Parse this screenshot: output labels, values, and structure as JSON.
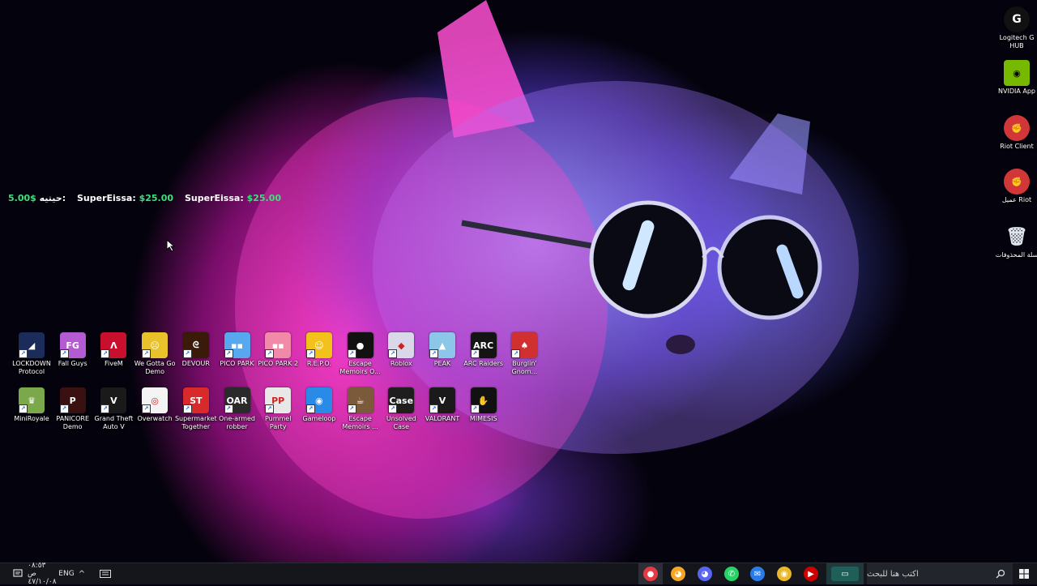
{
  "donations": [
    {
      "name": "حيتيه:",
      "amount": "5.00$"
    },
    {
      "name": "SuperEissa:",
      "amount": "$25.00"
    },
    {
      "name": "SuperEissa:",
      "amount": "$25.00"
    }
  ],
  "right_icons": [
    {
      "label": "Logitech G HUB",
      "icon": "logitech-g-icon"
    },
    {
      "label": "NVIDIA App",
      "icon": "nvidia-icon"
    },
    {
      "label": "Riot Client",
      "icon": "riot-icon"
    },
    {
      "label": "عميل Riot",
      "icon": "riot-icon"
    },
    {
      "label": "سلة المحذوفات",
      "icon": "recycle-bin-icon"
    }
  ],
  "row1": [
    {
      "label": "LOCKDOWN Protocol",
      "color": "#1c2c5a",
      "glyph": "◢"
    },
    {
      "label": "Fall Guys",
      "color": "#b45ad2",
      "glyph": "FG"
    },
    {
      "label": "FiveM",
      "color": "#c8102e",
      "glyph": "Λ"
    },
    {
      "label": "We Gotta Go Demo",
      "color": "#e8c12b",
      "glyph": "☹"
    },
    {
      "label": "DEVOUR",
      "color": "#3a1a08",
      "glyph": "ᘓ"
    },
    {
      "label": "PICO PARK",
      "color": "#58a8f0",
      "glyph": "▪▪"
    },
    {
      "label": "PICO PARK 2",
      "color": "#f08aa8",
      "glyph": "▪▪"
    },
    {
      "label": "R.E.P.O.",
      "color": "#f3c21a",
      "glyph": "☺"
    },
    {
      "label": "Escape Memoirs O...",
      "color": "#111111",
      "glyph": "●"
    },
    {
      "label": "Roblox",
      "color": "#d8d8e8",
      "glyph": "◆"
    },
    {
      "label": "PEAK",
      "color": "#8cc6e8",
      "glyph": "▲"
    },
    {
      "label": "ARC Raiders",
      "color": "#141414",
      "glyph": "ARC"
    },
    {
      "label": "Burglin' Gnom...",
      "color": "#d03030",
      "glyph": "♠"
    }
  ],
  "row2": [
    {
      "label": "MiniRoyale",
      "color": "#7aa84a",
      "glyph": "♛"
    },
    {
      "label": "PANICORE Demo",
      "color": "#3a1010",
      "glyph": "P"
    },
    {
      "label": "Grand Theft Auto V",
      "color": "#1a1a1a",
      "glyph": "V"
    },
    {
      "label": "Overwatch",
      "color": "#f4f4f4",
      "glyph": "◎"
    },
    {
      "label": "Supermarket Together",
      "color": "#d82a2a",
      "glyph": "ST"
    },
    {
      "label": "One-armed robber",
      "color": "#2a2a2a",
      "glyph": "OAR"
    },
    {
      "label": "Pummel Party",
      "color": "#e8e8e8",
      "glyph": "PP"
    },
    {
      "label": "Gameloop",
      "color": "#2a8ae8",
      "glyph": "◉"
    },
    {
      "label": "Escape Memoirs ...",
      "color": "#7a5a3a",
      "glyph": "☕"
    },
    {
      "label": "Unsolved Case",
      "color": "#1e1e1e",
      "glyph": "Case"
    },
    {
      "label": "VALORANT",
      "color": "#1a1a1a",
      "glyph": "V"
    },
    {
      "label": "MIMESIS",
      "color": "#111111",
      "glyph": "✋"
    }
  ],
  "taskbar": {
    "search_placeholder": "اكتب هنا للبحث",
    "language": "ENG",
    "time": "٠٨:٥٣ ص",
    "date": "٤٧/١٠/٠٨",
    "apps": [
      {
        "name": "app-red",
        "color": "#e63946",
        "glyph": "●"
      },
      {
        "name": "discord",
        "color": "#f5a623",
        "glyph": "◕"
      },
      {
        "name": "discord-blue",
        "color": "#5865f2",
        "glyph": "◕"
      },
      {
        "name": "whatsapp",
        "color": "#25d366",
        "glyph": "✆"
      },
      {
        "name": "mail",
        "color": "#2a7ae8",
        "glyph": "✉"
      },
      {
        "name": "chrome",
        "color": "#e8b72a",
        "glyph": "◉"
      },
      {
        "name": "youtube",
        "color": "#cc0000",
        "glyph": "▶"
      },
      {
        "name": "explorer",
        "color": "#1f5f5a",
        "glyph": "▭"
      }
    ]
  }
}
